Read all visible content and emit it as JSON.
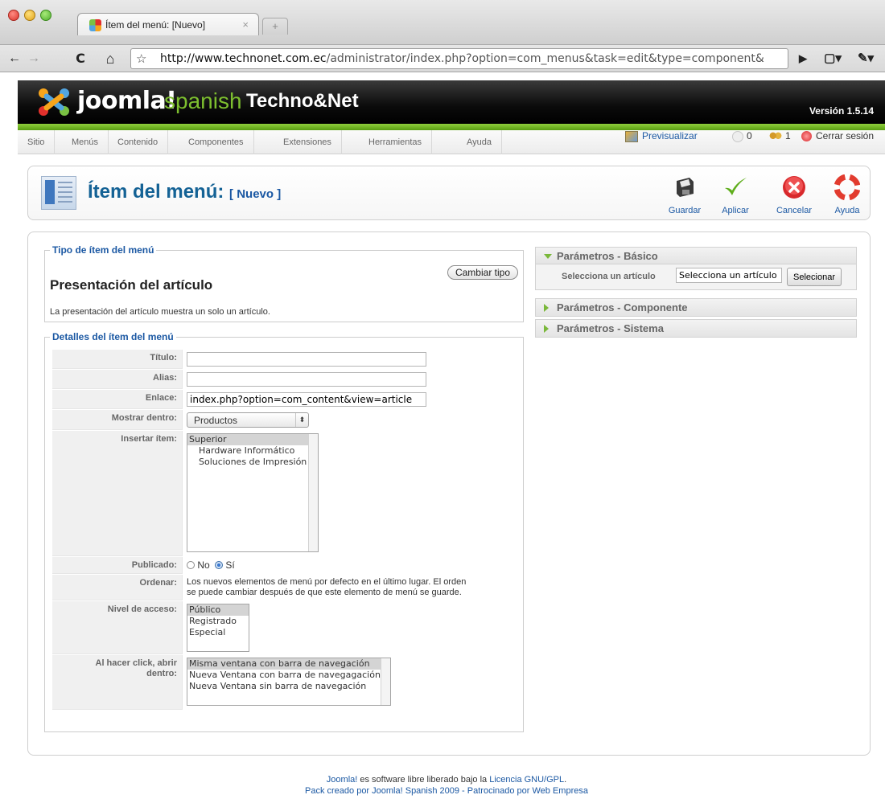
{
  "browser": {
    "tab_title": "Ítem del menú: [Nuevo]",
    "tab_close": "×",
    "new_tab": "+",
    "url_host": "http://www.technonet.com.ec",
    "url_path": "/administrator/index.php?option=com_menus&task=edit&type=component&",
    "back": "←",
    "forward": "→",
    "reload": "C",
    "home": "⌂",
    "star": "☆",
    "go": "▶",
    "page_menu": "▢▾",
    "tools_menu": "✎▾"
  },
  "header": {
    "logo_joomla": "joomla!",
    "logo_spanish": "spanish",
    "site_name": "Techno&Net",
    "version": "Versión 1.5.14"
  },
  "menu": {
    "items": [
      "Sitio",
      "Menús",
      "Contenido",
      "Componentes",
      "Extensiones",
      "Herramientas",
      "Ayuda"
    ],
    "preview": "Previsualizar",
    "messages_count": "0",
    "users_count": "1",
    "logout": "Cerrar sesión"
  },
  "title": {
    "main": "Ítem del menú:",
    "sub": "[ Nuevo ]"
  },
  "toolbar": {
    "save": "Guardar",
    "apply": "Aplicar",
    "cancel": "Cancelar",
    "help": "Ayuda"
  },
  "type_section": {
    "legend": "Tipo de ítem del menú",
    "change_button": "Cambiar tipo",
    "heading": "Presentación del artículo",
    "description": "La presentación del artículo muestra un solo un artículo."
  },
  "details": {
    "legend": "Detalles del ítem del menú",
    "title_label": "Título:",
    "title_value": "",
    "alias_label": "Alias:",
    "alias_value": "",
    "link_label": "Enlace:",
    "link_value": "index.php?option=com_content&view=article",
    "show_in_label": "Mostrar dentro:",
    "show_in_value": "Productos",
    "insert_label": "Insertar ítem:",
    "insert_options": [
      "Superior",
      "Hardware Informático",
      "Soluciones de Impresión"
    ],
    "published_label": "Publicado:",
    "published_no": "No",
    "published_yes": "Sí",
    "order_label": "Ordenar:",
    "order_text_1": "Los nuevos elementos de menú por defecto en el último lugar. El orden",
    "order_text_2": "se puede cambiar después de que este elemento de menú se guarde.",
    "access_label": "Nivel de acceso:",
    "access_options": [
      "Público",
      "Registrado",
      "Especial"
    ],
    "open_label_1": "Al hacer click, abrir",
    "open_label_2": "dentro:",
    "open_options": [
      "Misma ventana con barra de navegación",
      "Nueva Ventana con barra de navegagación",
      "Nueva Ventana sin barra de navegación"
    ]
  },
  "params": {
    "basic": "Parámetros - Básico",
    "select_article_label": "Selecciona un artículo",
    "select_article_value": "Selecciona un artículo",
    "select_button": "Selecionar",
    "component": "Parámetros - Componente",
    "system": "Parámetros - Sistema"
  },
  "footer": {
    "line1_link": "Joomla!",
    "line1_text": " es software libre liberado bajo la ",
    "line1_license": "Licencia GNU/GPL",
    "line1_end": ".",
    "line2_text": "Pack creado por Joomla! Spanish 2009 - Patrocinado por Web Empresa"
  }
}
